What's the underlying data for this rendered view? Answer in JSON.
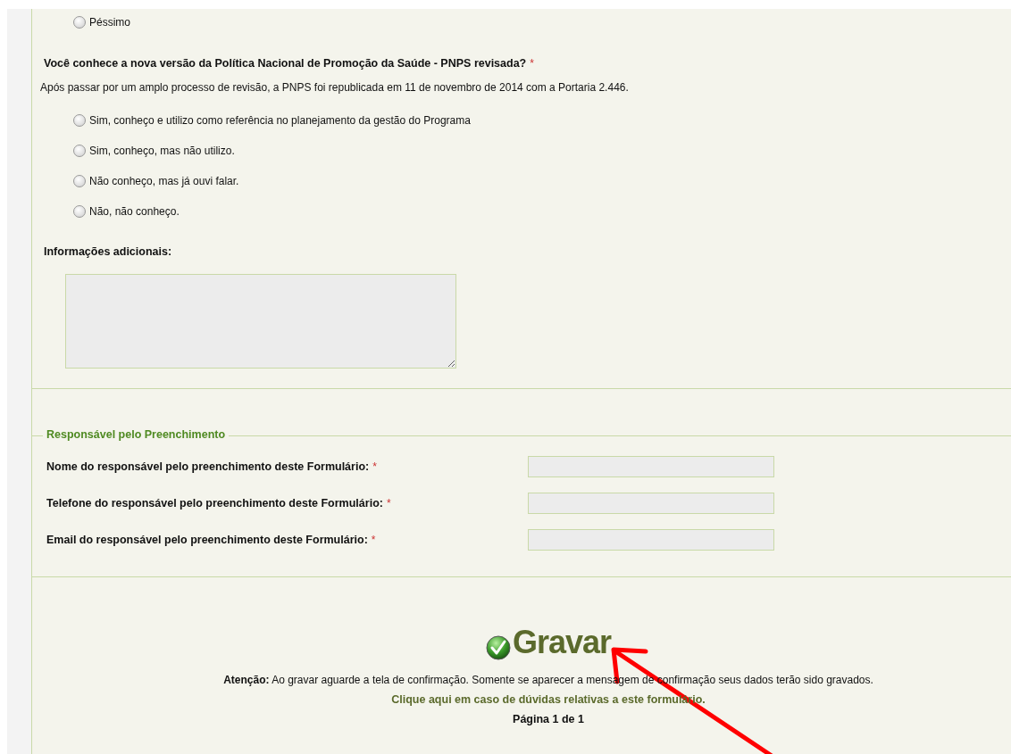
{
  "previous_question": {
    "options": [
      {
        "label": "Péssimo",
        "selected": false
      }
    ]
  },
  "question": {
    "title": "Você conhece a nova versão da Política Nacional de Promoção da Saúde - PNPS revisada?",
    "required": true,
    "required_mark": "*",
    "description": "Após passar por um amplo processo de revisão, a PNPS foi republicada em 11 de novembro de 2014 com a Portaria 2.446.",
    "options": [
      {
        "label": "Sim, conheço e utilizo como referência no planejamento da gestão do Programa",
        "selected": false
      },
      {
        "label": "Sim, conheço, mas não utilizo.",
        "selected": false
      },
      {
        "label": "Não conheço, mas já ouvi falar.",
        "selected": false
      },
      {
        "label": "Não, não conheço.",
        "selected": false
      }
    ]
  },
  "additional_info": {
    "label": "Informações adicionais:"
  },
  "responsible": {
    "legend": "Responsável pelo Preenchimento",
    "fields": [
      {
        "label": "Nome do responsável pelo preenchimento deste Formulário:",
        "required": true,
        "required_mark": "*"
      },
      {
        "label": "Telefone do responsável pelo preenchimento deste Formulário:",
        "required": true,
        "required_mark": "*"
      },
      {
        "label": "Email do responsável pelo preenchimento deste Formulário:",
        "required": true,
        "required_mark": "*"
      }
    ]
  },
  "save_button": {
    "label": "Gravar"
  },
  "notice": "**Atenção:** Ao gravar aguarde a tela de confirmação. Somente se aparecer a mensagem de confirmação seus dados terão sido gravados.",
  "help_link": "Clique aqui em caso de dúvidas relativas a este formulário.",
  "pagination": "Página 1 de 1"
}
